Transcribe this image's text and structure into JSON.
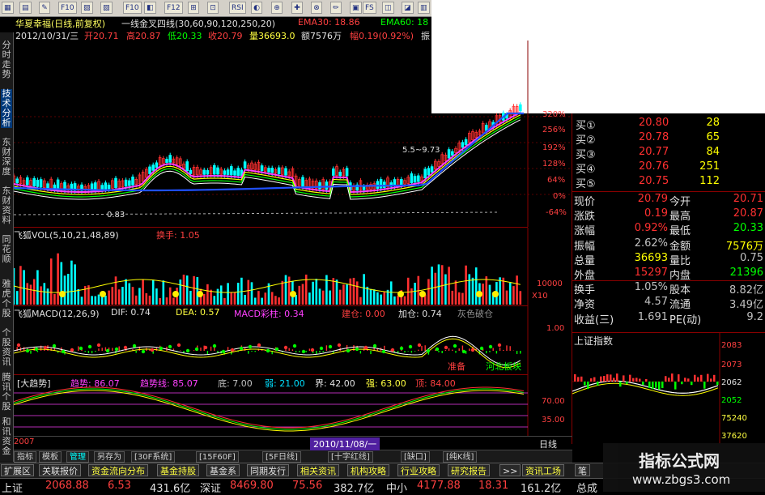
{
  "colors": {
    "up": "#ff3030",
    "down": "#00e0ff",
    "yellow": "#ffff00",
    "white": "#ffffff",
    "green": "#00ff00",
    "magenta": "#ff40ff",
    "blue": "#2050ff",
    "grey": "#c0c0c0"
  },
  "toolbar": {
    "buttons": [
      "",
      "",
      "",
      "F10",
      "",
      "",
      "F10",
      "",
      "F12",
      "",
      "",
      "RSI",
      "",
      "",
      "",
      "",
      "",
      "",
      "FS",
      "",
      "",
      ""
    ]
  },
  "main_chart": {
    "title": "华夏幸福(日线,前复权)",
    "indicator": "一线金叉四线(30,60,90,120,250,20)",
    "ema30": "EMA30: 18.86",
    "ema60": "EMA60: 18",
    "date": "2012/10/31/三",
    "open": "开20.71",
    "high": "高20.87",
    "low": "低20.33",
    "close": "收20.79",
    "volume": "量36693.0",
    "amount": "额7576万",
    "change": "幅0.19(0.92%)",
    "cut": "振",
    "annot_low": "0.83",
    "annot_high": "5.5~9.73",
    "axis": [
      "320%",
      "256%",
      "192%",
      "128%",
      "64%",
      "0%",
      "-64%"
    ]
  },
  "vol_chart": {
    "title": "飞狐VOL(5,10,21,48,89)",
    "turnover": "换手: 1.05",
    "axis": [
      "10000",
      "X10"
    ]
  },
  "macd_chart": {
    "title": "飞狐MACD(12,26,9)",
    "dif": "DIF: 0.74",
    "dea": "DEA: 0.57",
    "macd": "MACD彩柱: 0.34",
    "build": "建仓: 0.00",
    "add": "加仓: 0.74",
    "grey_label": "灰色破仓",
    "axis": [
      "1.00"
    ],
    "hint1": "准备",
    "hint2": "河北板块"
  },
  "trend_chart": {
    "title": "[大趋势]",
    "trend": "趋势: 86.07",
    "trend_line": "趋势线: 85.07",
    "bottom": "底: 7.00",
    "weak": "弱: 21.00",
    "boundary": "界: 42.00",
    "strong": "强: 63.00",
    "top": "顶: 84.00",
    "axis": [
      "70.00",
      "35.00"
    ]
  },
  "date_bar": {
    "left": "2007",
    "date": "2010/11/08/一",
    "period": "日线"
  },
  "side_tabs": [
    "分时走势",
    "技术分析",
    "东财深度",
    "东财资料",
    "同花顺",
    "雅虎个股",
    "个股资讯",
    "腾讯个股",
    "和讯资金"
  ],
  "quote": {
    "bids": [
      {
        "label": "买①",
        "price": "20.80",
        "vol": "28"
      },
      {
        "label": "买②",
        "price": "20.78",
        "vol": "65"
      },
      {
        "label": "买③",
        "price": "20.77",
        "vol": "84"
      },
      {
        "label": "买④",
        "price": "20.76",
        "vol": "251"
      },
      {
        "label": "买⑤",
        "price": "20.75",
        "vol": "112"
      }
    ],
    "rows": [
      {
        "l1": "现价",
        "v1": "20.79",
        "l2": "今开",
        "v2": "20.71"
      },
      {
        "l1": "涨跌",
        "v1": "0.19",
        "l2": "最高",
        "v2": "20.87"
      },
      {
        "l1": "涨幅",
        "v1": "0.92%",
        "l2": "最低",
        "v2": "20.33"
      },
      {
        "l1": "振幅",
        "v1": "2.62%",
        "l2": "金额",
        "v2": "7576万"
      },
      {
        "l1": "总量",
        "v1": "36693",
        "l2": "量比",
        "v2": "0.75"
      },
      {
        "l1": "外盘",
        "v1": "15297",
        "l2": "内盘",
        "v2": "21396"
      },
      {
        "l1": "换手",
        "v1": "1.05%",
        "l2": "股本",
        "v2": "8.82亿"
      },
      {
        "l1": "净资",
        "v1": "4.57",
        "l2": "流通",
        "v2": "3.49亿"
      },
      {
        "l1": "收益(三)",
        "v1": "1.691",
        "l2": "PE(动)",
        "v2": "9.2"
      }
    ]
  },
  "index_mini": {
    "title": "上证指数",
    "axis": [
      "2083",
      "2073",
      "2062",
      "2052",
      "75240",
      "37620"
    ]
  },
  "bottom_tabs": [
    "指标",
    "模板",
    "管理",
    "另存为",
    "[30F系统]",
    "[15F60F]",
    "[5F日线]",
    "[十字红线]",
    "[缺口]",
    "[纯K线]"
  ],
  "menu_tabs": [
    "扩展区",
    "关联报价",
    "资金流向分布",
    "基金持股",
    "基金系",
    "同期发行",
    "相关资讯",
    "机构攻略",
    "行业攻略",
    "研究报告",
    ">>",
    "资讯工场",
    "笔"
  ],
  "status": {
    "sh_label": "上证",
    "sh_val": "2068.88",
    "sh_chg": "6.53",
    "sh_amt": "431.6亿",
    "sz_label": "深证",
    "sz_val": "8469.80",
    "sz_chg": "75.56",
    "sz_amt": "382.7亿",
    "zx_label": "中小",
    "zx_val": "4177.88",
    "zx_chg": "18.31",
    "zx_amt": "161.2亿",
    "last": "总成"
  },
  "watermark": {
    "title": "指标公式网",
    "url": "www.zbgs3.com"
  }
}
